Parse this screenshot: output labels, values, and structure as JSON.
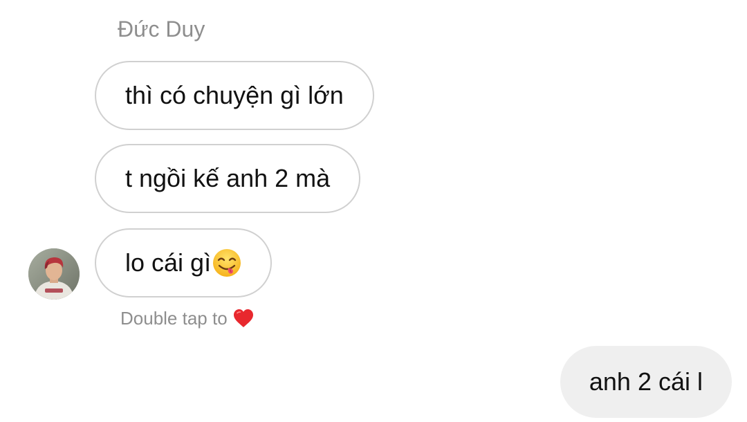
{
  "thread": {
    "sender_name": "Đức Duy",
    "incoming_messages": [
      {
        "text": "thì có chuyện gì lớn"
      },
      {
        "text": "t ngồi kế anh 2 mà"
      },
      {
        "text": "lo cái gì",
        "emoji": "savoring-food-face-emoji"
      }
    ],
    "reaction_hint": {
      "text": "Double tap to",
      "icon": "red-heart-icon",
      "icon_color": "#e8282e"
    },
    "outgoing_messages": [
      {
        "text": "anh 2 cái l"
      }
    ]
  }
}
